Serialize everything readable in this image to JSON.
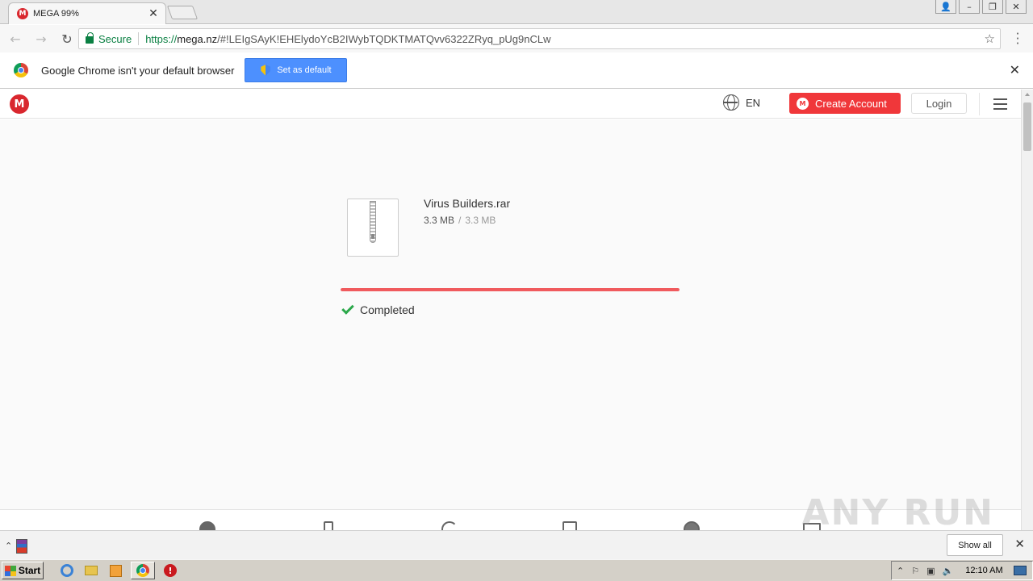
{
  "browser": {
    "tab": {
      "favicon": "M",
      "title": "MEGA 99%"
    },
    "address": {
      "secure_label": "Secure",
      "scheme": "https://",
      "host": "mega.nz",
      "path": "/#!LEIgSAyK!EHElydoYcB2IWybTQDKTMATQvv6322ZRyq_pUg9nCLw"
    },
    "infobar": {
      "message": "Google Chrome isn't your default browser",
      "button_label": "Set as default"
    }
  },
  "mega": {
    "logo": "M",
    "language": "EN",
    "create_account_label": "Create Account",
    "login_label": "Login"
  },
  "download": {
    "file_name": "Virus Builders.rar",
    "downloaded": "3.3 MB",
    "separator": "/",
    "total": "3.3 MB",
    "progress": 1.0,
    "status": "Completed"
  },
  "watermark": "ANY RUN",
  "shelf": {
    "show_all_label": "Show all"
  },
  "taskbar": {
    "start_label": "Start",
    "clock": "12:10 AM"
  },
  "colors": {
    "mega_red": "#d9272e",
    "create_btn": "#f0373a",
    "progress_fill": "#f05a5d",
    "secure_green": "#0b8043",
    "check_green": "#2ba84a",
    "infobar_button": "#4d90fe"
  }
}
